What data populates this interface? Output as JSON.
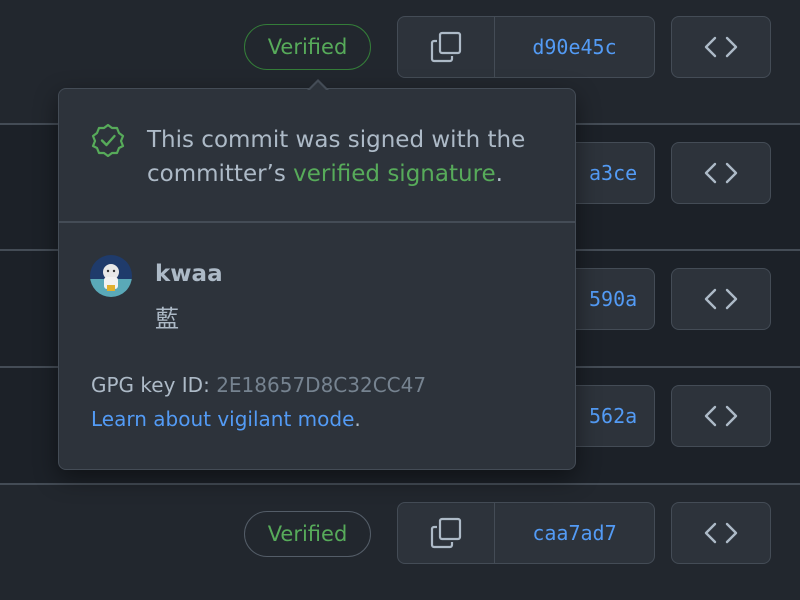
{
  "commits": [
    {
      "badge": "Verified",
      "sha": "d90e45c"
    },
    {
      "sha": "a3ce"
    },
    {
      "sha": "590a"
    },
    {
      "sha": "562a"
    },
    {
      "badge": "Verified",
      "sha": "caa7ad7"
    }
  ],
  "popover": {
    "message_prefix": "This commit was signed with the committer’s",
    "message_link": "verified signature",
    "message_suffix": ".",
    "user_name": "kwaa",
    "user_subtitle": "藍",
    "gpg_label": "GPG key ID:",
    "gpg_value": "2E18657D8C32CC47",
    "learn_link": "Learn about vigilant mode",
    "learn_suffix": "."
  },
  "icons": {
    "copy": "copy-icon",
    "code": "code-icon",
    "verified": "verified-check-icon"
  },
  "colors": {
    "background": "#22272e",
    "surface": "#2d333b",
    "border": "#444c56",
    "green": "#57ab5a",
    "link": "#539bf5"
  }
}
